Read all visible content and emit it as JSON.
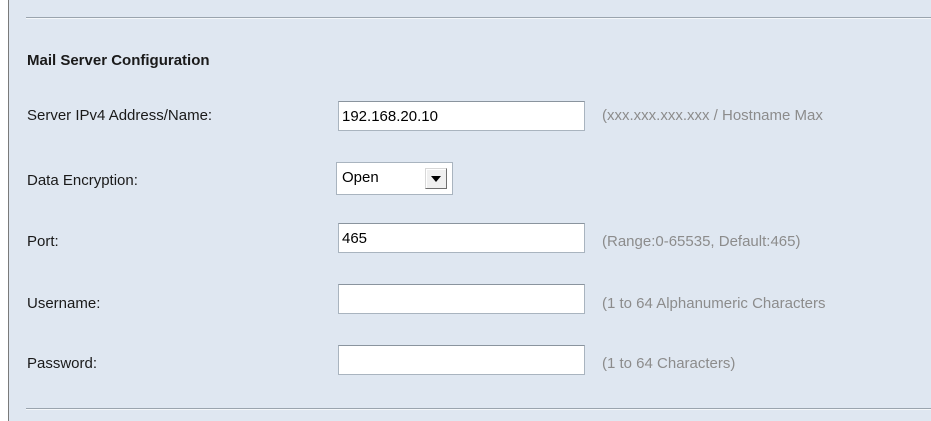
{
  "section": {
    "title": "Mail Server Configuration"
  },
  "fields": {
    "server": {
      "label": "Server IPv4 Address/Name:",
      "value": "192.168.20.10",
      "hint": "(xxx.xxx.xxx.xxx / Hostname Max"
    },
    "encryption": {
      "label": "Data Encryption:",
      "selected": "Open",
      "icon": "chevron-down-icon"
    },
    "port": {
      "label": "Port:",
      "value": "465",
      "hint": "(Range:0-65535, Default:465)"
    },
    "username": {
      "label": "Username:",
      "value": "",
      "hint": "(1 to 64 Alphanumeric Characters"
    },
    "password": {
      "label": "Password:",
      "value": "",
      "hint": "(1 to 64 Characters)"
    }
  },
  "colors": {
    "panel_background": "#dfe7f1",
    "hint_text": "#8c8c8c",
    "label_text": "#1a1a1a"
  }
}
